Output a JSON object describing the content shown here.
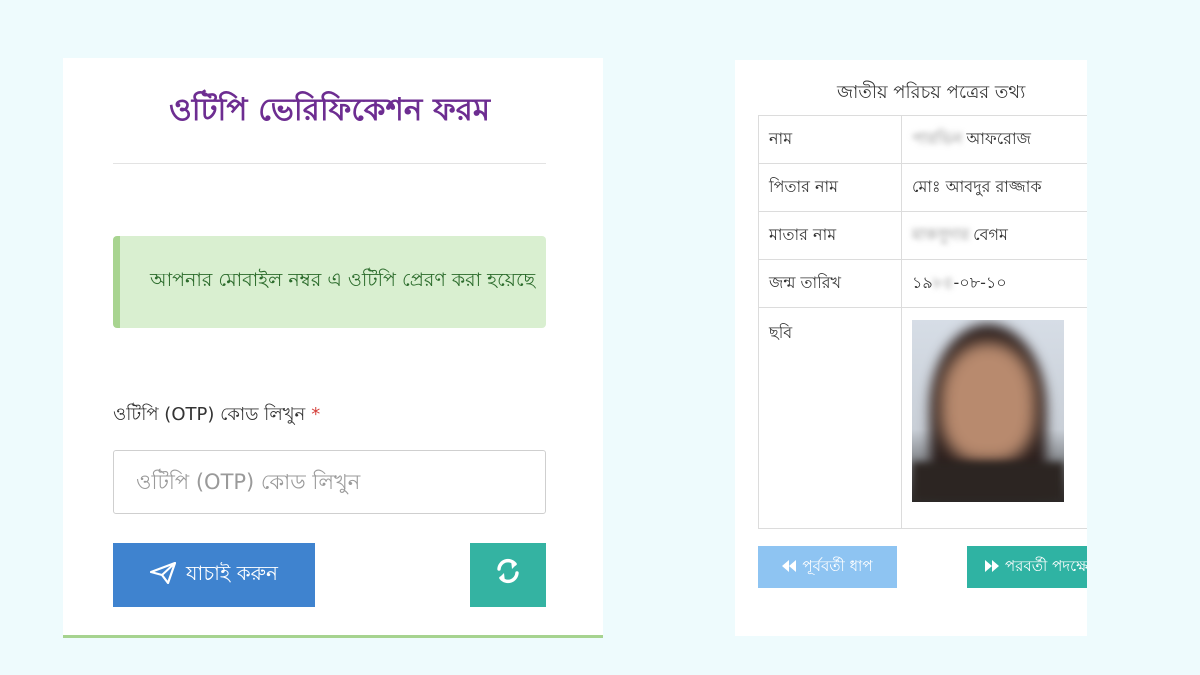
{
  "otp_form": {
    "title": "ওটিপি ভেরিফিকেশন ফরম",
    "alert_message": "আপনার মোবাইল নম্বর এ ওটিপি প্রেরণ করা হয়েছে",
    "field_label": "ওটিপি (OTP) কোড লিখুন",
    "required_mark": "*",
    "input_value": "",
    "input_placeholder": "ওটিপি (OTP) কোড লিখুন",
    "verify_label": "যাচাই করুন",
    "verify_icon": "paper-plane-icon",
    "refresh_icon": "refresh-icon",
    "colors": {
      "title": "#6d2d91",
      "alert_bg": "#d9efd0",
      "verify_button": "#3f83cf",
      "refresh_button": "#34b3a2"
    }
  },
  "nid_info": {
    "title": "জাতীয় পরিচয় পত্রের তথ্য",
    "rows": [
      {
        "key": "নাম",
        "value_hidden": "পারভিন",
        "value": "আফরোজ"
      },
      {
        "key": "পিতার নাম",
        "value_hidden": "",
        "value": "মোঃ আবদুর রাজ্জাক"
      },
      {
        "key": "মাতার নাম",
        "value_hidden": "মাকসুদার",
        "value": "বেগম"
      },
      {
        "key": "জন্ম তারিখ",
        "value_prefix": "১৯",
        "value_hidden": "৮৫",
        "value": "-০৮-১০"
      },
      {
        "key": "ছবি"
      }
    ],
    "prev_label": "পূর্ববর্তী ধাপ",
    "prev_icon": "double-chevron-left-icon",
    "next_label": "পরবর্তী পদক্ষেপ",
    "next_icon": "double-chevron-right-icon",
    "colors": {
      "prev_button": "#8ec4f2",
      "next_button": "#2fb3a3"
    }
  }
}
